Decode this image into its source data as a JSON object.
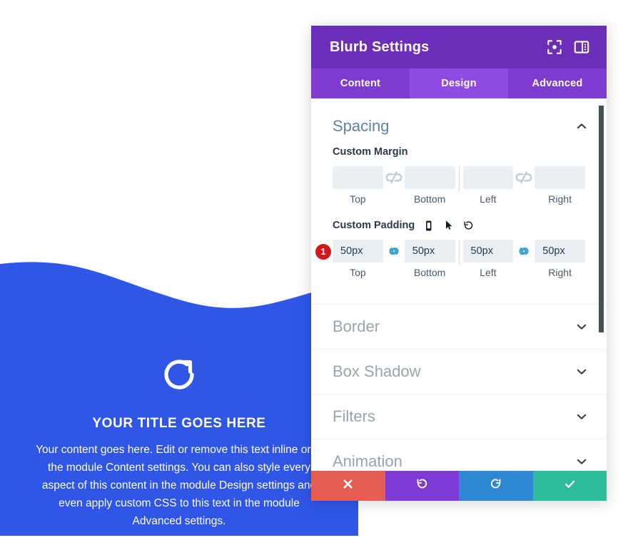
{
  "preview": {
    "name": "blurb-module-preview",
    "background_color": "#3056E8",
    "wave_color": "#3056E8",
    "icon": "refresh-circle-icon",
    "title": "YOUR TITLE GOES HERE",
    "body": "Your content goes here. Edit or remove this text inline or in the module Content settings. You can also style every aspect of this content in the module Design settings and even apply custom CSS to this text in the module Advanced settings."
  },
  "modal": {
    "title": "Blurb Settings",
    "header_color": "#6C2EB9",
    "tabbar_color": "#7E3BD0",
    "active_tab_color": "#8F4BE3",
    "header_icons": [
      {
        "name": "focus-target-icon",
        "label": "Focus"
      },
      {
        "name": "panel-layout-icon",
        "label": "Layout"
      }
    ],
    "tabs": [
      {
        "label": "Content",
        "active": false
      },
      {
        "label": "Design",
        "active": true
      },
      {
        "label": "Advanced",
        "active": false
      }
    ],
    "spacing": {
      "title": "Spacing",
      "title_color": "#5E82A4",
      "expanded": true,
      "chevron": "chevron-up-icon",
      "margin": {
        "label": "Custom Margin",
        "link_state": "unlinked",
        "link_icon": "broken-link-icon",
        "fields": [
          {
            "caption": "Top",
            "value": "",
            "placeholder": ""
          },
          {
            "caption": "Bottom",
            "value": "",
            "placeholder": ""
          },
          {
            "caption": "Left",
            "value": "",
            "placeholder": ""
          },
          {
            "caption": "Right",
            "value": "",
            "placeholder": ""
          }
        ]
      },
      "padding": {
        "label": "Custom Padding",
        "badge": "1",
        "badge_color": "#D4161A",
        "link_state": "linked",
        "link_icon": "chain-link-icon",
        "link_color": "#3BA3D4",
        "row_icons": [
          {
            "name": "phone-icon",
            "label": "Responsive"
          },
          {
            "name": "mouse-cursor-icon",
            "label": "Hover"
          },
          {
            "name": "reset-icon",
            "label": "Reset"
          }
        ],
        "fields": [
          {
            "caption": "Top",
            "value": "50px",
            "placeholder": ""
          },
          {
            "caption": "Bottom",
            "value": "50px",
            "placeholder": ""
          },
          {
            "caption": "Left",
            "value": "50px",
            "placeholder": ""
          },
          {
            "caption": "Right",
            "value": "50px",
            "placeholder": ""
          }
        ]
      }
    },
    "collapsed_sections": [
      {
        "label": "Border",
        "chevron": "chevron-down-icon"
      },
      {
        "label": "Box Shadow",
        "chevron": "chevron-down-icon"
      },
      {
        "label": "Filters",
        "chevron": "chevron-down-icon"
      },
      {
        "label": "Animation",
        "chevron": "chevron-down-icon"
      }
    ],
    "footer_buttons": [
      {
        "name": "cancel-button",
        "icon": "close-x-icon",
        "color": "#E45C52"
      },
      {
        "name": "undo-button",
        "icon": "undo-arrow-icon",
        "color": "#7D3AD4"
      },
      {
        "name": "redo-button",
        "icon": "redo-arrow-icon",
        "color": "#2D87D2"
      },
      {
        "name": "save-button",
        "icon": "checkmark-icon",
        "color": "#2CBB9B"
      }
    ],
    "scrollbar": {
      "name": "vertical-scrollbar",
      "color": "#41525F"
    }
  }
}
